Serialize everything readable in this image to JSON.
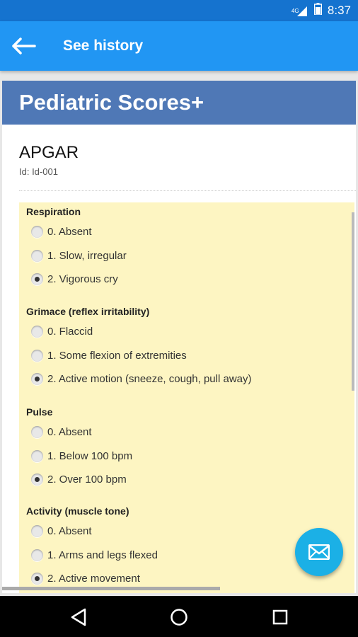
{
  "status_bar": {
    "time": "8:37",
    "network": "4G",
    "icons": [
      "signal-icon",
      "battery-icon"
    ]
  },
  "app_bar": {
    "title": "See history",
    "back_icon": "back-arrow-icon"
  },
  "banner": {
    "title": "Pediatric Scores+",
    "color": "#4f78b6"
  },
  "score": {
    "title": "APGAR",
    "id": "Id: Id-001"
  },
  "sections": [
    {
      "title": "Respiration",
      "options": [
        "0. Absent",
        "1. Slow, irregular",
        "2. Vigorous cry"
      ],
      "selected": 2
    },
    {
      "title": "Grimace (reflex irritability)",
      "options": [
        "0. Flaccid",
        "1. Some flexion of extremities",
        "2. Active motion (sneeze, cough, pull away)"
      ],
      "selected": 2
    },
    {
      "title": "Pulse",
      "options": [
        "0. Absent",
        "1. Below 100 bpm",
        "2. Over 100 bpm"
      ],
      "selected": 2
    },
    {
      "title": "Activity (muscle tone)",
      "options": [
        "0. Absent",
        "1. Arms and legs flexed",
        "2. Active movement"
      ],
      "selected": 2
    }
  ],
  "fab": {
    "icon": "mail-icon",
    "color": "#1bb0e6"
  },
  "nav_bar": {
    "icons": [
      "back-triangle-icon",
      "home-circle-icon",
      "recents-square-icon"
    ]
  },
  "colors": {
    "app_bar": "#2196f3",
    "status_bar": "#1573cf",
    "form_background": "#fdf5c2"
  }
}
